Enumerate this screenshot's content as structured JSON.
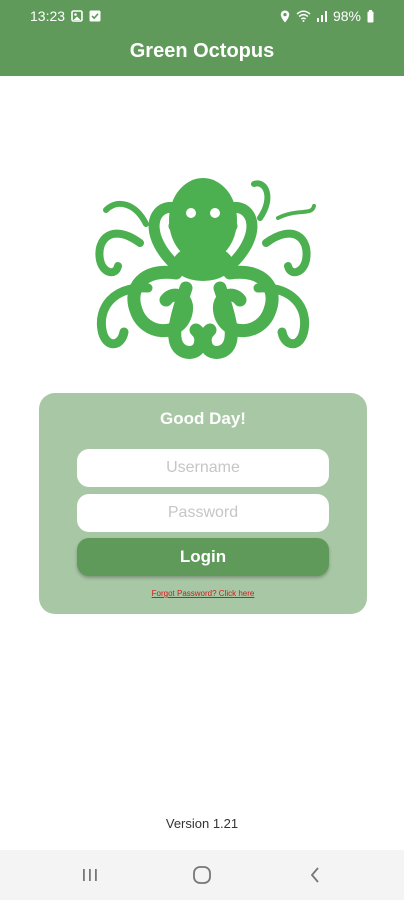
{
  "status_bar": {
    "time": "13:23",
    "battery": "98%",
    "icons": [
      "gallery-icon",
      "check-icon",
      "location-icon",
      "wifi-icon",
      "signal-icon",
      "battery-icon"
    ]
  },
  "app_bar": {
    "title": "Green Octopus"
  },
  "logo": {
    "icon": "octopus-icon",
    "color": "#4caf50"
  },
  "login_card": {
    "greeting": "Good Day!",
    "username": {
      "value": "",
      "placeholder": "Username"
    },
    "password": {
      "value": "",
      "placeholder": "Password"
    },
    "login_label": "Login",
    "forgot_label": "Forgot Password? Click here"
  },
  "footer": {
    "version": "Version 1.21"
  },
  "nav_bar": {
    "icons": [
      "recents-icon",
      "home-icon",
      "back-icon"
    ]
  },
  "colors": {
    "primary": "#5f9a5b",
    "card": "#a8c7a5",
    "logo": "#4caf50",
    "link": "#d11a1a"
  }
}
